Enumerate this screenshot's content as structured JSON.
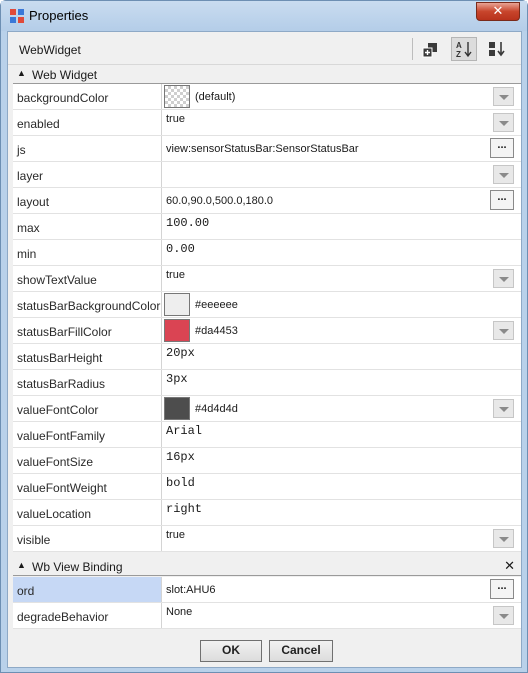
{
  "window": {
    "title": "Properties",
    "close_symbol": "✕"
  },
  "toolbar": {
    "title": "WebWidget"
  },
  "sections": {
    "web_widget": "Web Widget",
    "view_binding": "Wb View Binding",
    "close_symbol": "✕",
    "chevron_symbol": "▲"
  },
  "properties": [
    {
      "name": "backgroundColor",
      "value": "(default)",
      "swatch": "checker",
      "editor": "dropdown"
    },
    {
      "name": "enabled",
      "value": "true",
      "editor": "dropdown"
    },
    {
      "name": "js",
      "value": "view:sensorStatusBar:SensorStatusBar",
      "editor": "ellipsis"
    },
    {
      "name": "layer",
      "value": "",
      "editor": "dropdown"
    },
    {
      "name": "layout",
      "value": "60.0,90.0,500.0,180.0",
      "editor": "ellipsis"
    },
    {
      "name": "max",
      "value": "100.00",
      "editor": "text"
    },
    {
      "name": "min",
      "value": "0.00",
      "editor": "text"
    },
    {
      "name": "showTextValue",
      "value": "true",
      "editor": "dropdown"
    },
    {
      "name": "statusBarBackgroundColor",
      "value": "#eeeeee",
      "swatch": "#eeeeee",
      "editor": "none"
    },
    {
      "name": "statusBarFillColor",
      "value": "#da4453",
      "swatch": "#da4453",
      "editor": "dropdown"
    },
    {
      "name": "statusBarHeight",
      "value": "20px",
      "editor": "text"
    },
    {
      "name": "statusBarRadius",
      "value": "3px",
      "editor": "text"
    },
    {
      "name": "valueFontColor",
      "value": "#4d4d4d",
      "swatch": "#4d4d4d",
      "editor": "dropdown"
    },
    {
      "name": "valueFontFamily",
      "value": "Arial",
      "editor": "text"
    },
    {
      "name": "valueFontSize",
      "value": "16px",
      "editor": "text"
    },
    {
      "name": "valueFontWeight",
      "value": "bold",
      "editor": "text"
    },
    {
      "name": "valueLocation",
      "value": "right",
      "editor": "text"
    },
    {
      "name": "visible",
      "value": "true",
      "editor": "dropdown"
    }
  ],
  "binding": [
    {
      "name": "ord",
      "value": "slot:AHU6",
      "editor": "ellipsis",
      "selected": true
    },
    {
      "name": "degradeBehavior",
      "value": "None",
      "editor": "dropdown"
    }
  ],
  "buttons": {
    "ok": "OK",
    "cancel": "Cancel",
    "ellipsis": "..."
  },
  "colors": {
    "title_bg": "#b9d1ea",
    "selected_row": "#c6d8f5",
    "close_red": "#c8452c"
  }
}
